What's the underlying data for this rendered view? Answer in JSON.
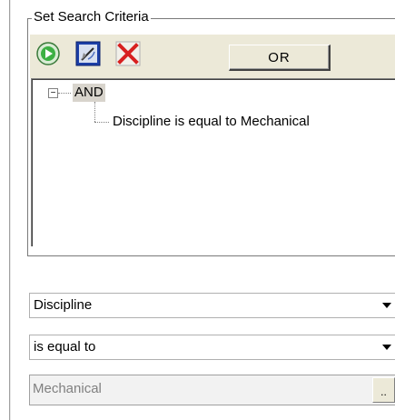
{
  "criteria_group": {
    "title": "Set Search Criteria",
    "toolbar": {
      "run_icon": "run-icon",
      "edit_icon": "edit-criteria-icon",
      "delete_icon": "delete-icon",
      "or_label": "OR"
    },
    "tree": {
      "root_label": "AND",
      "root_expander": "−",
      "child_label": "Discipline is equal to Mechanical"
    }
  },
  "fields": {
    "property": "Discipline",
    "operator": "is equal to",
    "value": "Mechanical",
    "value_button": ".."
  },
  "colors": {
    "run_icon": "#3cb043",
    "edit_icon_bg": "#1c3fa8",
    "delete_icon": "#d82020",
    "toolbar_bg": "#ece9d8"
  }
}
